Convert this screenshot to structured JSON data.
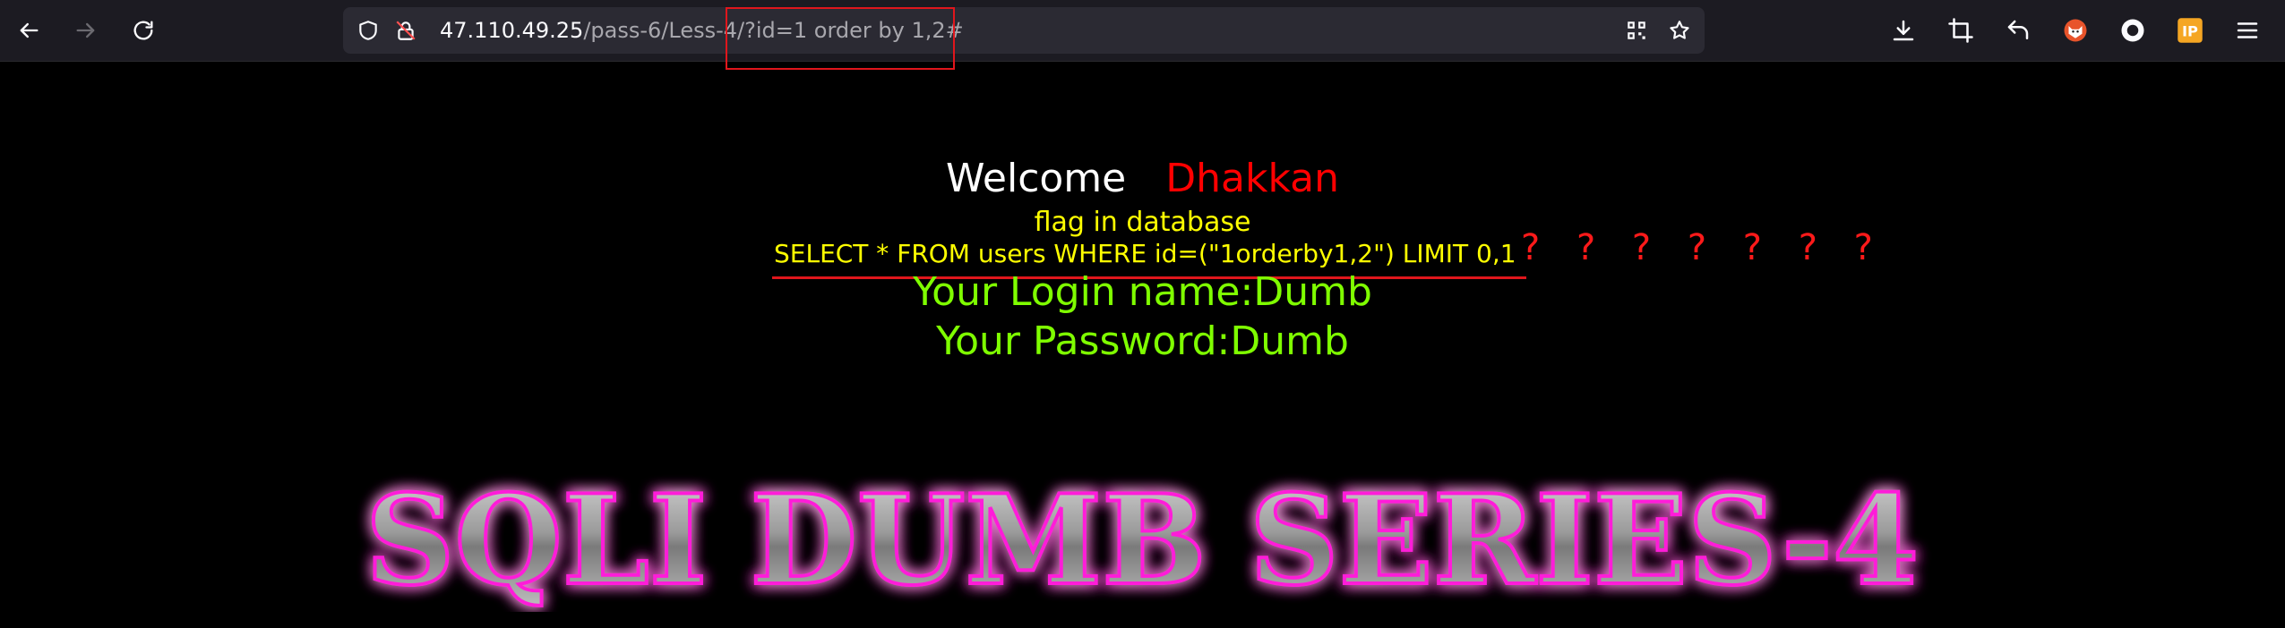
{
  "browser": {
    "nav": {
      "back_icon": "back-arrow-icon",
      "forward_icon": "forward-arrow-icon",
      "reload_icon": "reload-icon"
    },
    "address_bar": {
      "host": "47.110.49.25",
      "path": "/pass-6/Less-4/",
      "query": "?id=1 order by 1,2#",
      "highlight_color": "#e0161c"
    },
    "toolbar_icons": [
      "qr-code-icon",
      "bookmark-star-icon",
      "download-icon",
      "screenshot-crop-icon",
      "undo-icon",
      "extension-fox-icon",
      "record-icon",
      "ip-extension-icon",
      "menu-icon"
    ],
    "ip_badge": "IP"
  },
  "page": {
    "welcome": "Welcome",
    "username_display": "Dhakkan",
    "flag_hint": "flag in database",
    "sql_query": "SELECT * FROM users WHERE id=(\"1orderby1,2\") LIMIT 0,1",
    "question_marks": "? ? ? ? ? ? ?",
    "login_name": "Your Login name:Dumb",
    "password": "Your Password:Dumb",
    "banner_title": "SQLI DUMB SERIES-4"
  },
  "colors": {
    "background": "#000000",
    "welcome": "#ffffff",
    "name": "#ff0000",
    "flag": "#ffff00",
    "login": "#7fff00",
    "annotation": "#e0161c",
    "banner_glow": "#ff1ad9"
  }
}
